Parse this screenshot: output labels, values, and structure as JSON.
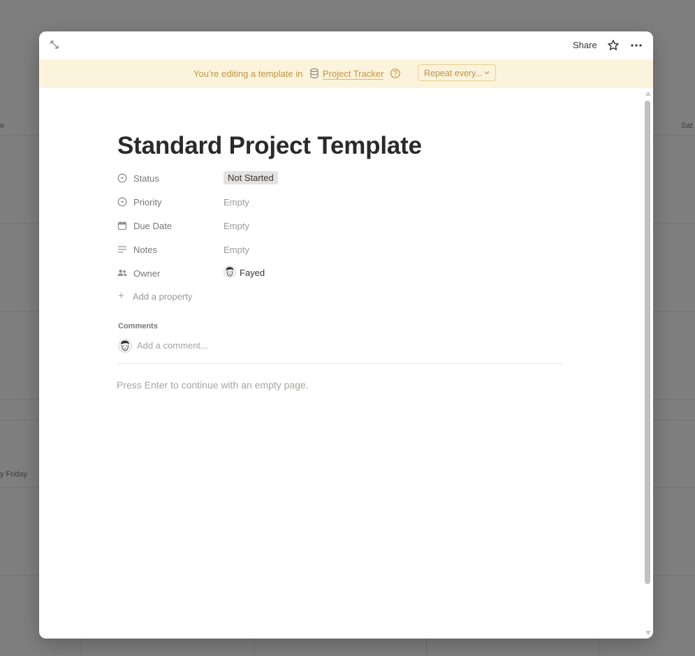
{
  "background": {
    "day_header_left_fragment": "e",
    "day_header_right": "Sat",
    "event_fragment": "y Friday"
  },
  "topbar": {
    "expand_icon": "expand-icon",
    "share_label": "Share",
    "favorite_icon": "star-icon",
    "more_icon": "more-horizontal-icon"
  },
  "banner": {
    "text": "You’re editing a template in",
    "database_icon": "database-icon",
    "database_name": "Project Tracker",
    "help_icon": "question-circle-icon",
    "repeat_label": "Repeat every...",
    "color_bg": "#fbf3db",
    "color_text": "#c29343"
  },
  "page": {
    "title": "Standard Project Template",
    "properties": [
      {
        "name": "Status",
        "icon": "status-icon",
        "value": "Not Started",
        "type": "status"
      },
      {
        "name": "Priority",
        "icon": "select-icon",
        "value": "Empty",
        "type": "select"
      },
      {
        "name": "Due Date",
        "icon": "calendar-icon",
        "value": "Empty",
        "type": "date"
      },
      {
        "name": "Notes",
        "icon": "text-icon",
        "value": "Empty",
        "type": "text"
      },
      {
        "name": "Owner",
        "icon": "people-icon",
        "value": "Fayed",
        "type": "person"
      }
    ],
    "add_property_label": "Add a property",
    "comments_heading": "Comments",
    "comment_placeholder": "Add a comment...",
    "empty_hint": "Press Enter to continue with an empty page."
  }
}
